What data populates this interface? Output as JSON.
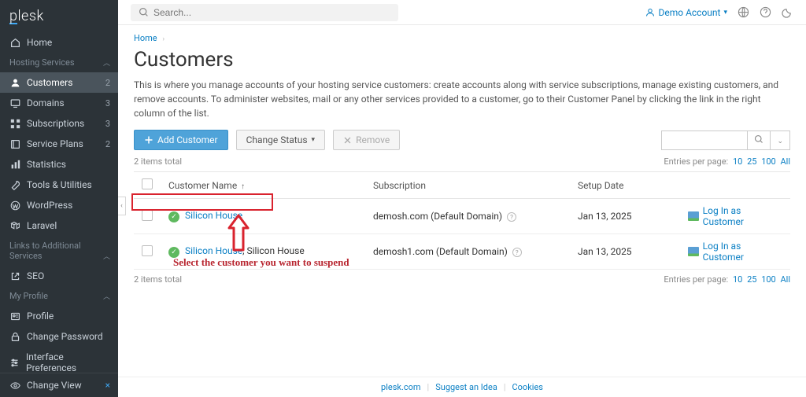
{
  "logo": "plesk",
  "topbar": {
    "search_placeholder": "Search...",
    "account_label": "Demo Account"
  },
  "sidebar": {
    "home": "Home",
    "section_hosting": "Hosting Services",
    "customers": "Customers",
    "customers_badge": "2",
    "domains": "Domains",
    "domains_badge": "3",
    "subscriptions": "Subscriptions",
    "subscriptions_badge": "3",
    "service_plans": "Service Plans",
    "service_plans_badge": "2",
    "statistics": "Statistics",
    "tools": "Tools & Utilities",
    "wordpress": "WordPress",
    "laravel": "Laravel",
    "section_links": "Links to Additional Services",
    "seo": "SEO",
    "section_profile": "My Profile",
    "profile": "Profile",
    "change_password": "Change Password",
    "interface_prefs": "Interface Preferences",
    "change_view": "Change View"
  },
  "breadcrumb": {
    "home": "Home"
  },
  "page_title": "Customers",
  "page_desc": "This is where you manage accounts of your hosting service customers: create accounts along with service subscriptions, manage existing customers, and remove accounts. To administer websites, mail or any other services provided to a customer, go to their Customer Panel by clicking the link in the right column of the list.",
  "actions": {
    "add_customer": "Add Customer",
    "change_status": "Change Status",
    "remove": "Remove"
  },
  "table": {
    "total_top": "2 items total",
    "total_bottom": "2 items total",
    "entries_label": "Entries per page:",
    "entries_10": "10",
    "entries_25": "25",
    "entries_100": "100",
    "entries_all": "All",
    "col_name": "Customer Name",
    "col_sort": "↑",
    "col_subscription": "Subscription",
    "col_setup": "Setup Date",
    "rows": [
      {
        "name": "Silicon House",
        "extra": "",
        "sub_main": "demosh.com (Default Domain)",
        "date": "Jan 13, 2025",
        "login": "Log In as Customer"
      },
      {
        "name": "Silicon House",
        "extra": ", Silicon House",
        "sub_main": "demosh1.com (Default Domain)",
        "date": "Jan 13, 2025",
        "login": "Log In as Customer"
      }
    ]
  },
  "annotation": {
    "text": "Select the customer you want to suspend"
  },
  "footer": {
    "plesk": "plesk.com",
    "suggest": "Suggest an Idea",
    "cookies": "Cookies"
  }
}
